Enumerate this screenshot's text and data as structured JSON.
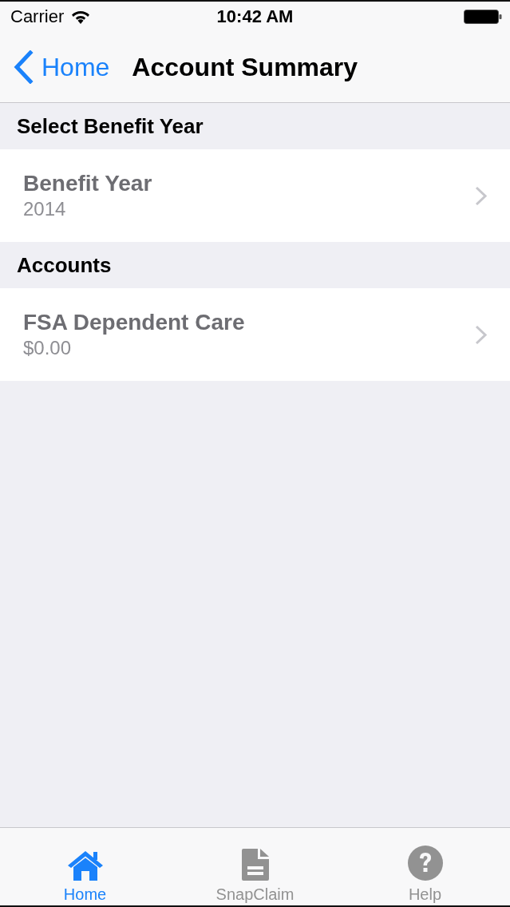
{
  "status_bar": {
    "carrier": "Carrier",
    "time": "10:42 AM"
  },
  "nav_bar": {
    "back": "Home",
    "title": "Account Summary"
  },
  "sections": [
    {
      "header": "Select Benefit Year",
      "rows": [
        {
          "title": "Benefit Year",
          "detail": "2014"
        }
      ]
    },
    {
      "header": "Accounts",
      "rows": [
        {
          "title": "FSA Dependent Care",
          "detail": "$0.00"
        }
      ]
    }
  ],
  "tab_bar": [
    {
      "label": "Home",
      "kind": "home",
      "selected": true
    },
    {
      "label": "SnapClaim",
      "kind": "document",
      "selected": false
    },
    {
      "label": "Help",
      "kind": "help",
      "selected": false
    }
  ]
}
